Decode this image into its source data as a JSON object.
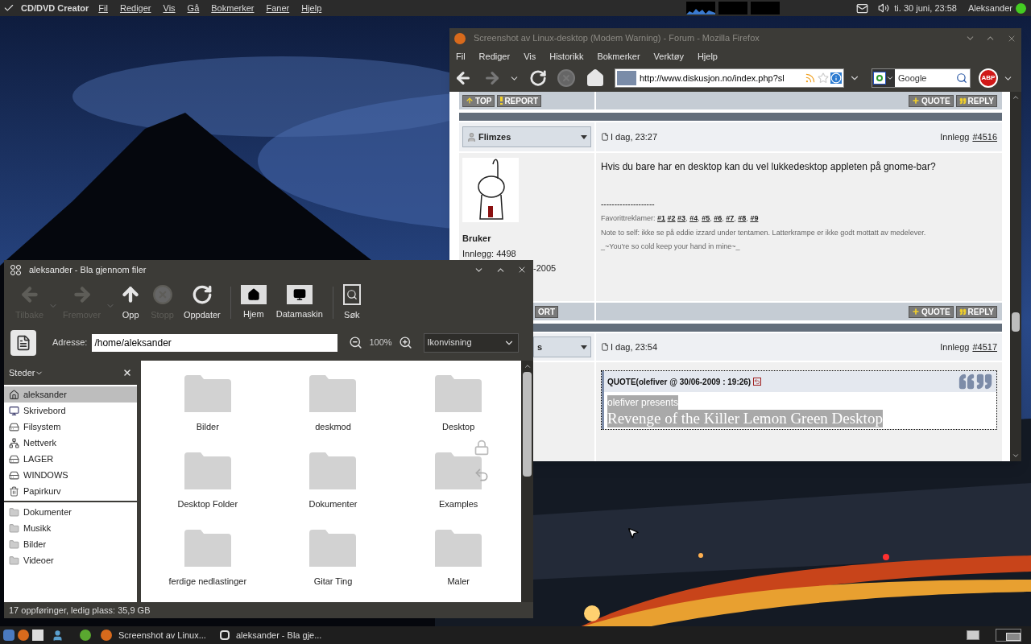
{
  "top_panel": {
    "app_name": "CD/DVD Creator",
    "menus": [
      "Fil",
      "Rediger",
      "Vis",
      "Gå",
      "Bokmerker",
      "Faner",
      "Hjelp"
    ],
    "clock": "ti. 30 juni, 23:58",
    "user": "Aleksander",
    "online": true
  },
  "firefox": {
    "title": "Screenshot av Linux-desktop (Modem Warning) - Forum - Mozilla Firefox",
    "menus": [
      "Fil",
      "Rediger",
      "Vis",
      "Historikk",
      "Bokmerker",
      "Verktøy",
      "Hjelp"
    ],
    "url": "http://www.diskusjon.no/index.php?sl",
    "search": {
      "placeholder": "Google"
    },
    "adblock": "ABP",
    "forum": {
      "actions_1": {
        "left": [
          "TOP",
          "REPORT"
        ],
        "right": [
          "QUOTE",
          "REPLY"
        ]
      },
      "post_1": {
        "author": "Flimzes",
        "date": "I dag, 23:27",
        "post_label": "Innlegg",
        "post_number": "#4516",
        "rank": "Bruker",
        "count": "Innlegg: 4498",
        "joined": "-2005",
        "message": "Hvis du bare har en desktop kan du vel lukkedesktop appleten på gnome-bar?",
        "sig_rule": "--------------------",
        "sig_label": "Favorittreklamer:",
        "sig_links": [
          {
            "text": "#1"
          },
          {
            "text": "#2"
          },
          {
            "text": "#3",
            "after": ","
          },
          {
            "text": "#4",
            "after": ","
          },
          {
            "text": "#5",
            "after": ","
          },
          {
            "text": "#6",
            "after": ","
          },
          {
            "text": "#7",
            "after": ","
          },
          {
            "text": "#8",
            "after": ","
          },
          {
            "text": "#9"
          }
        ],
        "sig_lines": [
          "Note to self: ikke se på eddie izzard under tentamen. Latterkrampe er ikke godt mottatt av medelever.",
          "_~You're so cold keep your hand in mine~_"
        ]
      },
      "actions_2": {
        "left": [
          "ORT"
        ],
        "right": [
          "QUOTE",
          "REPLY"
        ]
      },
      "post_2": {
        "author": "s",
        "date": "I dag, 23:54",
        "post_label": "Innlegg",
        "post_number": "#4517",
        "quote": {
          "header": "QUOTE(olefiver @ 30/06-2009 : 19:26)",
          "lines": [
            {
              "text": "olefiver presents",
              "kind": "small",
              "selected": true
            },
            {
              "text": "Revenge of the Killer Lemon Green Desktop",
              "kind": "title",
              "selected": true
            }
          ]
        }
      }
    }
  },
  "file_manager": {
    "title": "aleksander - Bla gjennom filer",
    "toolbar": [
      {
        "label": "Tilbake",
        "kind": "back",
        "disabled": true
      },
      {
        "label": "Fremover",
        "kind": "forward",
        "disabled": true
      },
      {
        "label": "Opp",
        "kind": "up",
        "disabled": false
      },
      {
        "label": "Stopp",
        "kind": "stop",
        "disabled": true
      },
      {
        "label": "Oppdater",
        "kind": "reload",
        "disabled": false
      },
      {
        "label": "Hjem",
        "kind": "home",
        "disabled": false
      },
      {
        "label": "Datamaskin",
        "kind": "computer",
        "disabled": false
      },
      {
        "label": "Søk",
        "kind": "search",
        "disabled": false
      }
    ],
    "address_label": "Adresse:",
    "address": "/home/aleksander",
    "zoom": "100%",
    "view": "Ikonvisning",
    "sidebar_title": "Steder",
    "places": [
      {
        "label": "aleksander",
        "kind": "home",
        "selected": true
      },
      {
        "label": "Skrivebord",
        "kind": "desktop",
        "selected": false
      },
      {
        "label": "Filsystem",
        "kind": "drive",
        "selected": false
      },
      {
        "label": "Nettverk",
        "kind": "network",
        "selected": false
      },
      {
        "label": "LAGER",
        "kind": "drive",
        "selected": false
      },
      {
        "label": "WINDOWS",
        "kind": "drive",
        "selected": false
      },
      {
        "label": "Papirkurv",
        "kind": "trash",
        "selected": false
      }
    ],
    "bookmarks": [
      {
        "label": "Dokumenter",
        "selected": false
      },
      {
        "label": "Musikk",
        "selected": false
      },
      {
        "label": "Bilder",
        "selected": false
      },
      {
        "label": "Videoer",
        "selected": false
      }
    ],
    "files": [
      {
        "name": "Bilder"
      },
      {
        "name": "deskmod"
      },
      {
        "name": "Desktop"
      },
      {
        "name": "Desktop Folder"
      },
      {
        "name": "Dokumenter"
      },
      {
        "name": "Examples",
        "locked": true,
        "symlink": true
      },
      {
        "name": "ferdige nedlastinger"
      },
      {
        "name": "Gitar Ting"
      },
      {
        "name": "Maler"
      }
    ],
    "status": "17 oppføringer, ledig plass: 35,9 GB"
  },
  "taskbar": {
    "tasks": [
      "Screenshot av Linux...",
      "aleksander - Bla gje..."
    ]
  }
}
